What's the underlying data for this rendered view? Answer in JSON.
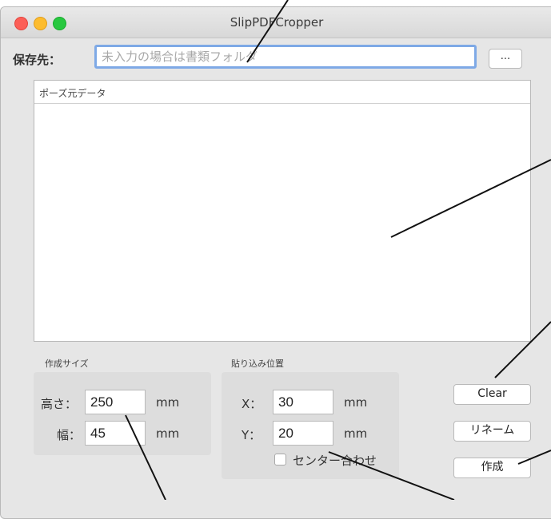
{
  "window": {
    "title": "SlipPDFCropper"
  },
  "save": {
    "label": "保存先：",
    "placeholder": "未入力の場合は書類フォルダ",
    "value": "",
    "browse_label": "..."
  },
  "list": {
    "header": "ポーズ元データ"
  },
  "size_group": {
    "title": "作成サイズ",
    "height_label": "高さ：",
    "height_value": "250",
    "height_unit": "mm",
    "width_label": "幅：",
    "width_value": "45",
    "width_unit": "mm"
  },
  "pos_group": {
    "title": "貼り込み位置",
    "x_label": "X：",
    "x_value": "30",
    "x_unit": "mm",
    "y_label": "Y：",
    "y_value": "20",
    "y_unit": "mm",
    "center_label": "センター合わせ",
    "center_checked": false
  },
  "buttons": {
    "clear": "Clear",
    "rename": "リネーム",
    "create": "作成"
  }
}
